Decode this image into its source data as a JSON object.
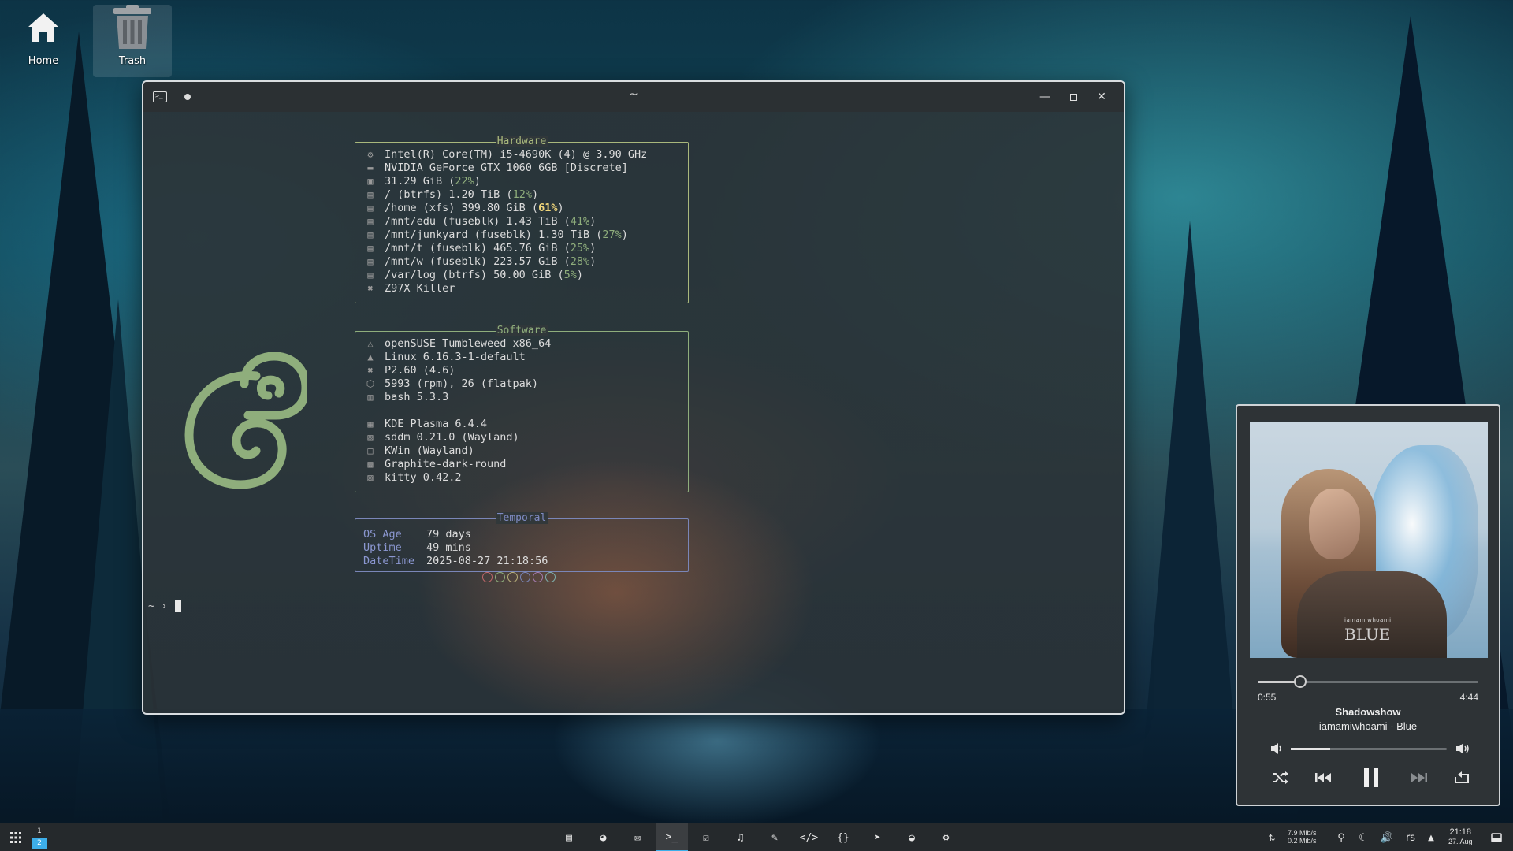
{
  "desktop": {
    "icons": [
      {
        "label": "Home",
        "icon": "home-icon"
      },
      {
        "label": "Trash",
        "icon": "trash-icon"
      }
    ]
  },
  "window": {
    "title": "~",
    "controls": [
      "minimize",
      "maximize",
      "close"
    ]
  },
  "fetch": {
    "hardware": {
      "title": "Hardware",
      "lines": [
        {
          "icon": "cpu-icon",
          "text": "Intel(R) Core(TM) i5-4690K (4) @ 3.90 GHz"
        },
        {
          "icon": "gpu-icon",
          "text": "NVIDIA GeForce GTX 1060 6GB [Discrete]"
        },
        {
          "icon": "memory-icon",
          "text": "31.29 GiB (",
          "pct": "22%",
          "tail": ")"
        },
        {
          "icon": "disk-icon",
          "text": "/ (btrfs) 1.20 TiB (",
          "pct": "12%",
          "tail": ")"
        },
        {
          "icon": "disk-icon",
          "text": "/home (xfs) 399.80 GiB (",
          "pct": "61%",
          "tail": ")",
          "warn": true
        },
        {
          "icon": "disk-icon",
          "text": "/mnt/edu (fuseblk) 1.43 TiB (",
          "pct": "41%",
          "tail": ")"
        },
        {
          "icon": "disk-icon",
          "text": "/mnt/junkyard (fuseblk) 1.30 TiB (",
          "pct": "27%",
          "tail": ")"
        },
        {
          "icon": "disk-icon",
          "text": "/mnt/t (fuseblk) 465.76 GiB (",
          "pct": "25%",
          "tail": ")"
        },
        {
          "icon": "disk-icon",
          "text": "/mnt/w (fuseblk) 223.57 GiB (",
          "pct": "28%",
          "tail": ")"
        },
        {
          "icon": "disk-icon",
          "text": "/var/log (btrfs) 50.00 GiB (",
          "pct": "5%",
          "tail": ")"
        },
        {
          "icon": "tools-icon",
          "text": "Z97X Killer"
        }
      ]
    },
    "software": {
      "title": "Software",
      "lines": [
        {
          "icon": "distro-icon",
          "text": "openSUSE Tumbleweed x86_64"
        },
        {
          "icon": "kernel-icon",
          "text": "Linux 6.16.3-1-default"
        },
        {
          "icon": "tools-icon",
          "text": "P2.60 (4.6)"
        },
        {
          "icon": "package-icon",
          "text": "5993 (rpm), 26 (flatpak)"
        },
        {
          "icon": "shell-icon",
          "text": "bash 5.3.3"
        },
        {
          "icon": "",
          "text": ""
        },
        {
          "icon": "desktop-icon",
          "text": "KDE Plasma 6.4.4"
        },
        {
          "icon": "login-icon",
          "text": "sddm 0.21.0 (Wayland)"
        },
        {
          "icon": "window-icon",
          "text": "KWin (Wayland)"
        },
        {
          "icon": "theme-icon",
          "text": "Graphite-dark-round"
        },
        {
          "icon": "terminal-icon",
          "text": "kitty 0.42.2"
        }
      ]
    },
    "temporal": {
      "title": "Temporal",
      "rows": [
        {
          "key": "OS Age",
          "value": "79 days"
        },
        {
          "key": "Uptime",
          "value": "49 mins"
        },
        {
          "key": "DateTime",
          "value": "2025-08-27 21:18:56"
        }
      ]
    },
    "color_dots": [
      "#c0676b",
      "#8fae7c",
      "#b8b07a",
      "#7a86b8",
      "#a67cb0",
      "#7fb0ad"
    ],
    "prompt": "~ ›"
  },
  "player": {
    "album_artist_tag": "iamamiwhoami",
    "album_title_tag": "BLUE",
    "position": "0:55",
    "duration": "4:44",
    "progress": 0.194,
    "volume": 0.25,
    "track_title": "Shadowshow",
    "track_subtitle": "iamamiwhoami - Blue"
  },
  "taskbar": {
    "pager": [
      "1",
      "2"
    ],
    "apps": [
      "file-manager-icon",
      "browser-icon",
      "mail-icon",
      "terminal-icon",
      "tasks-icon",
      "music-icon",
      "editor-icon",
      "code-icon",
      "braces-icon",
      "telegram-icon",
      "discord-icon",
      "steam-icon"
    ],
    "net_down": "7.9 Mib/s",
    "net_up": "0.2 Mib/s",
    "keyboard_layout": "rs",
    "time": "21:18",
    "date": "27. Aug",
    "accent": "#3daee9"
  }
}
